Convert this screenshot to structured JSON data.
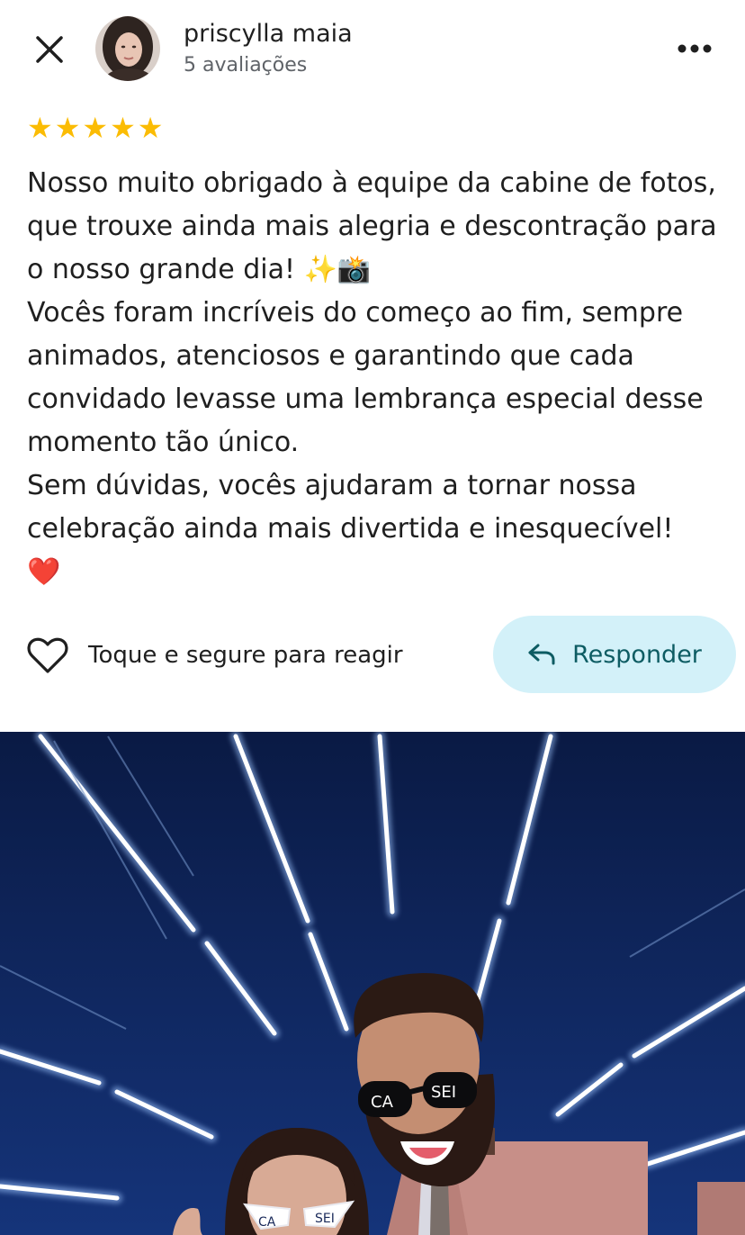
{
  "header": {
    "close_icon": "close-icon",
    "user_name": "priscylla maia",
    "user_meta": "5 avaliações",
    "more_icon": "more-horizontal-icon"
  },
  "review": {
    "rating": 5,
    "rating_max": 5,
    "star_color": "#fbbc04",
    "lines": [
      "Nosso muito obrigado à equipe da cabine de fotos, que trouxe ainda mais alegria e descontração para o nosso grande dia! ✨📸",
      "Vocês foram incríveis do começo ao fim, sempre animados, atenciosos e garantindo que cada convidado levasse uma lembrança especial desse momento tão único.",
      "Sem dúvidas, vocês ajudaram a tornar nossa celebração ainda mais divertida e inesquecível!",
      "❤️"
    ]
  },
  "actions": {
    "react_label": "Toque e segure para reagir",
    "react_icon": "heart-outline-icon",
    "reply_label": "Responder",
    "reply_icon": "reply-arrow-icon",
    "reply_bg": "#d3f1f9"
  },
  "photo": {
    "glasses_left_text": "CA",
    "glasses_right_text": "SEI"
  }
}
